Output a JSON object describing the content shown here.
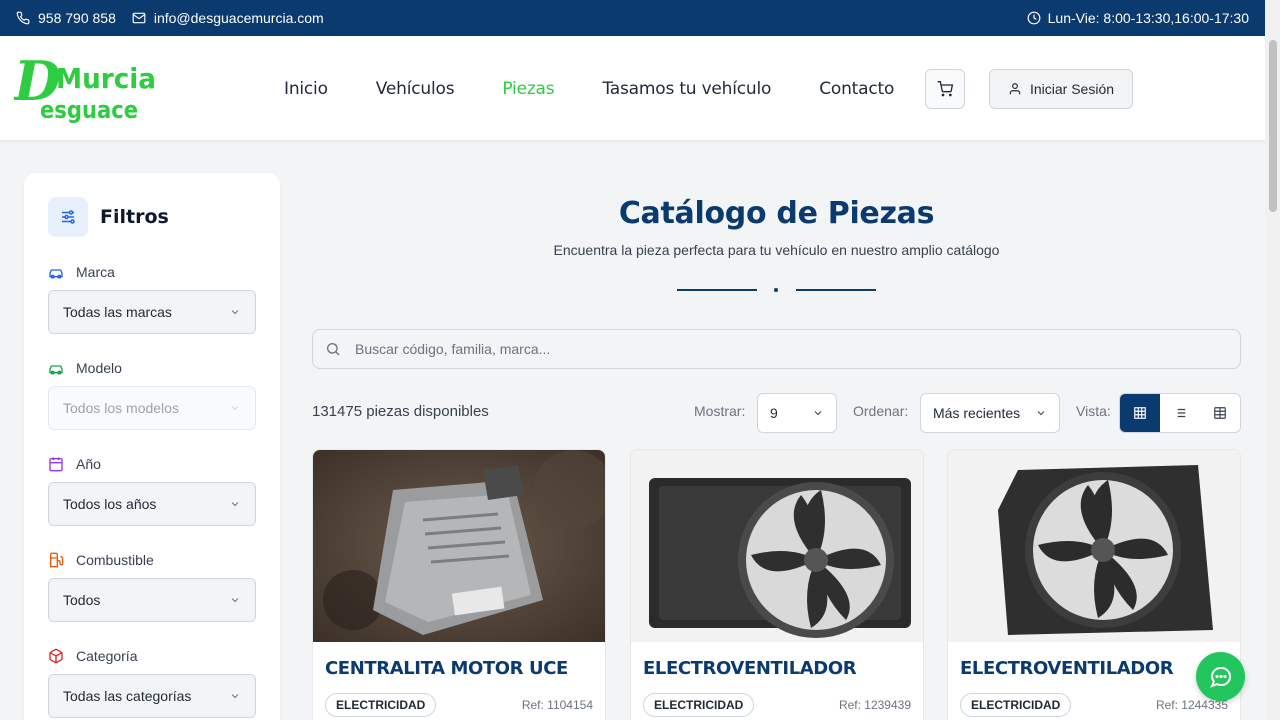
{
  "topbar": {
    "phone": "958 790 858",
    "email": "info@desguacemurcia.com",
    "hours": "Lun-Vie: 8:00-13:30,16:00-17:30"
  },
  "logo": {
    "line1": "Murcia",
    "line2": "esguace",
    "initial": "D",
    "color": "#2ecc40"
  },
  "nav": {
    "items": [
      {
        "label": "Inicio",
        "active": false
      },
      {
        "label": "Vehículos",
        "active": false
      },
      {
        "label": "Piezas",
        "active": true
      },
      {
        "label": "Tasamos tu vehículo",
        "active": false
      },
      {
        "label": "Contacto",
        "active": false
      }
    ],
    "login_label": "Iniciar Sesión"
  },
  "sidebar": {
    "title": "Filtros",
    "filters": [
      {
        "label": "Marca",
        "value": "Todas las marcas",
        "icon": "car-icon",
        "disabled": false
      },
      {
        "label": "Modelo",
        "value": "Todos los modelos",
        "icon": "car-icon",
        "disabled": true
      },
      {
        "label": "Año",
        "value": "Todos los años",
        "icon": "calendar-icon",
        "disabled": false
      },
      {
        "label": "Combustible",
        "value": "Todos",
        "icon": "fuel-icon",
        "disabled": false
      },
      {
        "label": "Categoría",
        "value": "Todas las categorías",
        "icon": "box-icon",
        "disabled": false
      }
    ]
  },
  "main": {
    "title": "Catálogo de Piezas",
    "subtitle": "Encuentra la pieza perfecta para tu vehículo en nuestro amplio catálogo",
    "search_placeholder": "Buscar código, familia, marca...",
    "count": "131475 piezas disponibles",
    "show_label": "Mostrar:",
    "show_value": "9",
    "order_label": "Ordenar:",
    "order_value": "Más recientes",
    "view_label": "Vista:"
  },
  "cards": [
    {
      "title": "CENTRALITA MOTOR UCE",
      "category": "ELECTRICIDAD",
      "ref": "Ref: 1104154"
    },
    {
      "title": "ELECTROVENTILADOR",
      "category": "ELECTRICIDAD",
      "ref": "Ref: 1239439"
    },
    {
      "title": "ELECTROVENTILADOR",
      "category": "ELECTRICIDAD",
      "ref": "Ref: 1244335"
    }
  ],
  "colors": {
    "primary": "#0b3a6e",
    "accent_green": "#2ecc40",
    "chat_green": "#22c55e"
  }
}
